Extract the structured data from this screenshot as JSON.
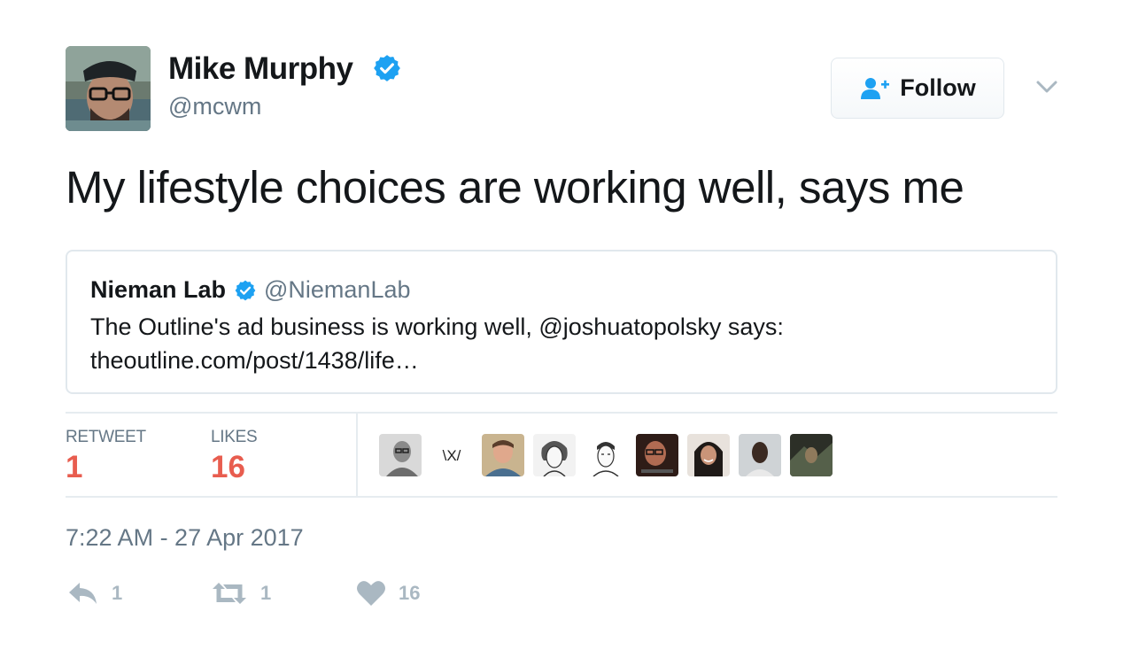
{
  "author": {
    "name": "Mike Murphy",
    "handle": "@mcwm",
    "verified": true
  },
  "follow_button": {
    "label": "Follow",
    "icon": "follow-user-icon"
  },
  "more_menu": {
    "icon": "chevron-down-icon"
  },
  "tweet": {
    "text": "My lifestyle choices are working well, says me"
  },
  "quoted_tweet": {
    "name": "Nieman Lab",
    "handle": "@NiemanLab",
    "verified": true,
    "text": "The Outline's ad business is working well, @joshuatopolsky says: theoutline.com/post/1438/life…"
  },
  "stats": {
    "retweets_label": "RETWEET",
    "retweets_count": "1",
    "likes_label": "LIKES",
    "likes_count": "16"
  },
  "likers": [
    {
      "icon": "avatar-photo"
    },
    {
      "icon": "avatar-logo-text",
      "text": "\\X/"
    },
    {
      "icon": "avatar-photo"
    },
    {
      "icon": "avatar-sketch"
    },
    {
      "icon": "avatar-sketch"
    },
    {
      "icon": "avatar-photo"
    },
    {
      "icon": "avatar-photo"
    },
    {
      "icon": "avatar-photo"
    },
    {
      "icon": "avatar-photo"
    }
  ],
  "timestamp": "7:22 AM - 27 Apr 2017",
  "actions": {
    "reply_count": "1",
    "retweet_count": "1",
    "like_count": "16"
  },
  "colors": {
    "verified": "#1da1f2",
    "stat_value": "#e85d4f",
    "muted": "#657786",
    "action": "#aab8c2",
    "follow_icon": "#1da1f2"
  }
}
